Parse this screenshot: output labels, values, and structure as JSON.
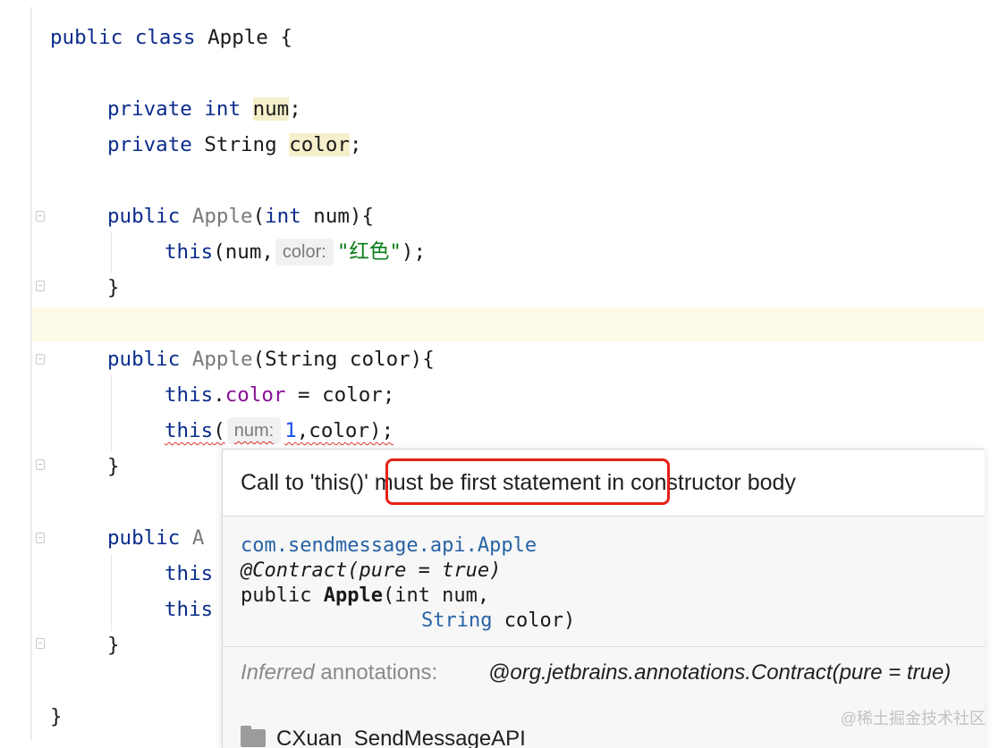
{
  "code": {
    "line1": {
      "kw": "public class",
      "rest": " Apple {"
    },
    "line2": {
      "kw1": "private",
      "kw2": "int",
      "field": "num",
      "end": ";"
    },
    "line3": {
      "kw": "private",
      "type": "String",
      "field": "color",
      "end": ";"
    },
    "line4": {
      "kw1": "public",
      "name": "Apple",
      "open": "(",
      "kw2": "int",
      "rest": " num){"
    },
    "line5": {
      "kw": "this",
      "open": "(num,",
      "hint": "color:",
      "str": "\"红色\"",
      "end": ");"
    },
    "line6": {
      "text": "}"
    },
    "line7": {
      "kw": "public",
      "name": "Apple",
      "rest": "(String color){"
    },
    "line8": {
      "kw": "this",
      "dot": ".",
      "field": "color",
      "rest": " = color;"
    },
    "line9": {
      "kw": "this",
      "open": "(",
      "hint": "num:",
      "num": "1",
      "rest": ",color);"
    },
    "line10": {
      "text": "}"
    },
    "line11": {
      "kw": "public",
      "partial": "A"
    },
    "line12": {
      "kw": "this"
    },
    "line13": {
      "kw": "this"
    },
    "line14": {
      "text": "}"
    },
    "line15": {
      "text": "}"
    }
  },
  "popup": {
    "message_a": "Call to 'this()'",
    "message_b": " must be first statement ",
    "message_c": "in constructor body",
    "doc_class": "com.sendmessage.api.Apple",
    "doc_annotation": "@Contract(pure = true)",
    "doc_sig_prefix": "public ",
    "doc_sig_name": "Apple",
    "doc_sig_params1": "(int num,",
    "doc_sig_type": "String",
    "doc_sig_params2": " color)",
    "inferred_italic": "Inferred",
    "inferred_label": " annotations:",
    "inferred_value": "@org.jetbrains.annotations.Contract(pure = true)",
    "module_name": "CXuan_SendMessageAPI"
  },
  "watermark": "@稀土掘金技术社区",
  "colors": {
    "error": "#e8201a",
    "keyword": "#0b2c8c",
    "string": "#067d17",
    "field": "#871094"
  }
}
